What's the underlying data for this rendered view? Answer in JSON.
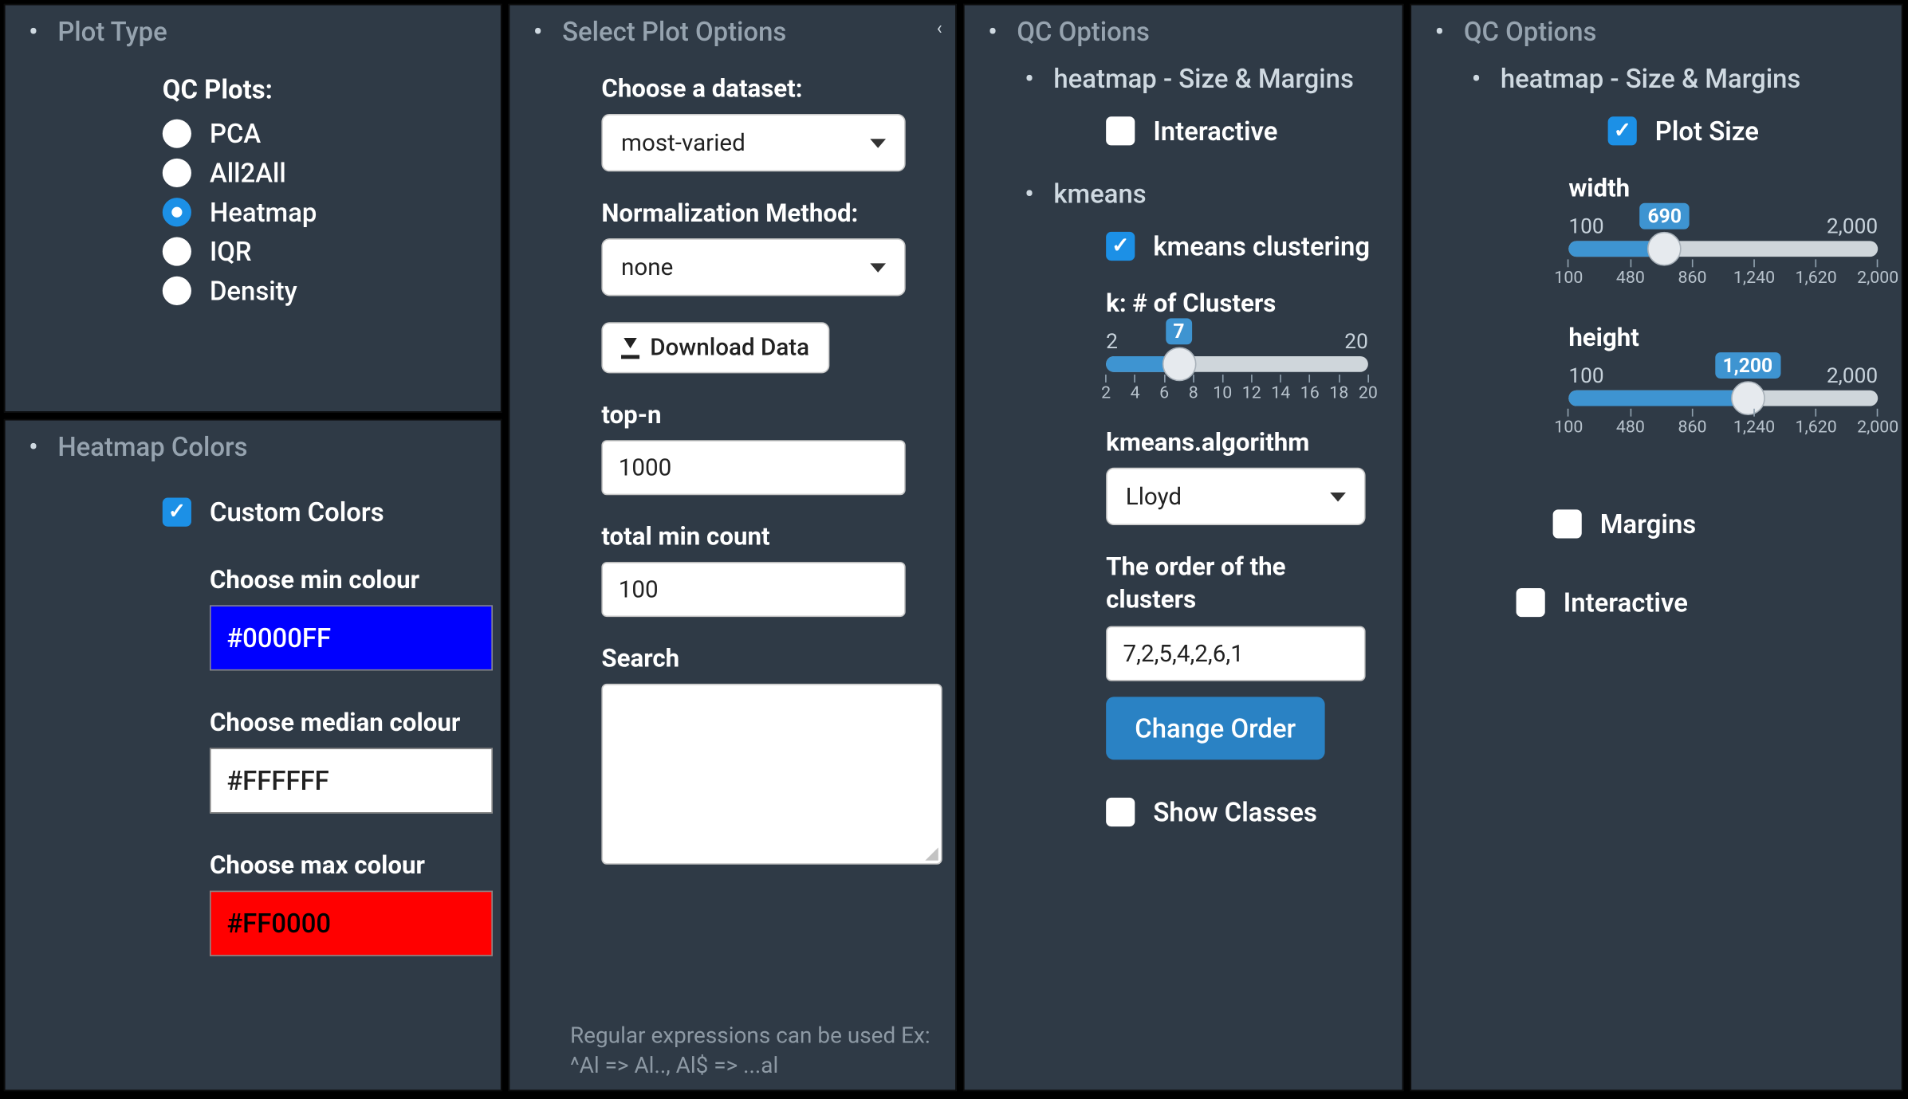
{
  "panel_plot_type": {
    "title": "Plot Type",
    "group_label": "QC Plots:",
    "options": [
      "PCA",
      "All2All",
      "Heatmap",
      "IQR",
      "Density"
    ],
    "selected": "Heatmap"
  },
  "panel_heatmap_colors": {
    "title": "Heatmap Colors",
    "custom_label": "Custom Colors",
    "custom_checked": true,
    "min_label": "Choose min colour",
    "min_value": "#0000FF",
    "median_label": "Choose median colour",
    "median_value": "#FFFFFF",
    "max_label": "Choose max colour",
    "max_value": "#FF0000"
  },
  "panel_select_plot": {
    "title": "Select Plot Options",
    "dataset_label": "Choose a dataset:",
    "dataset_value": "most-varied",
    "norm_label": "Normalization Method:",
    "norm_value": "none",
    "download_label": "Download Data",
    "topn_label": "top-n",
    "topn_value": "1000",
    "minc_label": "total min count",
    "minc_value": "100",
    "search_label": "Search",
    "search_value": "",
    "hint": "Regular expressions can be used Ex: ^Al => Al.., Al$ => ...al"
  },
  "panel_qc1": {
    "title": "QC Options",
    "sub": "heatmap - Size & Margins",
    "interactive_label": "Interactive",
    "interactive_checked": false,
    "kmeans_sec": "kmeans",
    "kmeans_chk_label": "kmeans clustering",
    "kmeans_checked": true,
    "k_label": "k: # of Clusters",
    "k_min": 2,
    "k_max": 20,
    "k_value": 7,
    "k_ticks": [
      2,
      4,
      6,
      8,
      10,
      12,
      14,
      16,
      18,
      20
    ],
    "algo_label": "kmeans.algorithm",
    "algo_value": "Lloyd",
    "order_label": "The order of the clusters",
    "order_value": "7,2,5,4,2,6,1",
    "change_order_label": "Change Order",
    "show_classes_label": "Show Classes",
    "show_classes_checked": false
  },
  "panel_qc2": {
    "title": "QC Options",
    "sub": "heatmap - Size & Margins",
    "plot_size_label": "Plot Size",
    "plot_size_checked": true,
    "width_label": "width",
    "width_min": 100,
    "width_max": 2000,
    "width_value": 690,
    "width_ticks": [
      "100",
      "480",
      "860",
      "1,240",
      "1,620",
      "2,000"
    ],
    "width_bubble": "690",
    "height_label": "height",
    "height_min": 100,
    "height_max": 2000,
    "height_value": 1200,
    "height_ticks": [
      "100",
      "480",
      "860",
      "1,240",
      "1,620",
      "2,000"
    ],
    "height_bubble": "1,200",
    "margins_label": "Margins",
    "margins_checked": false,
    "interactive_label": "Interactive",
    "interactive_checked": false
  }
}
